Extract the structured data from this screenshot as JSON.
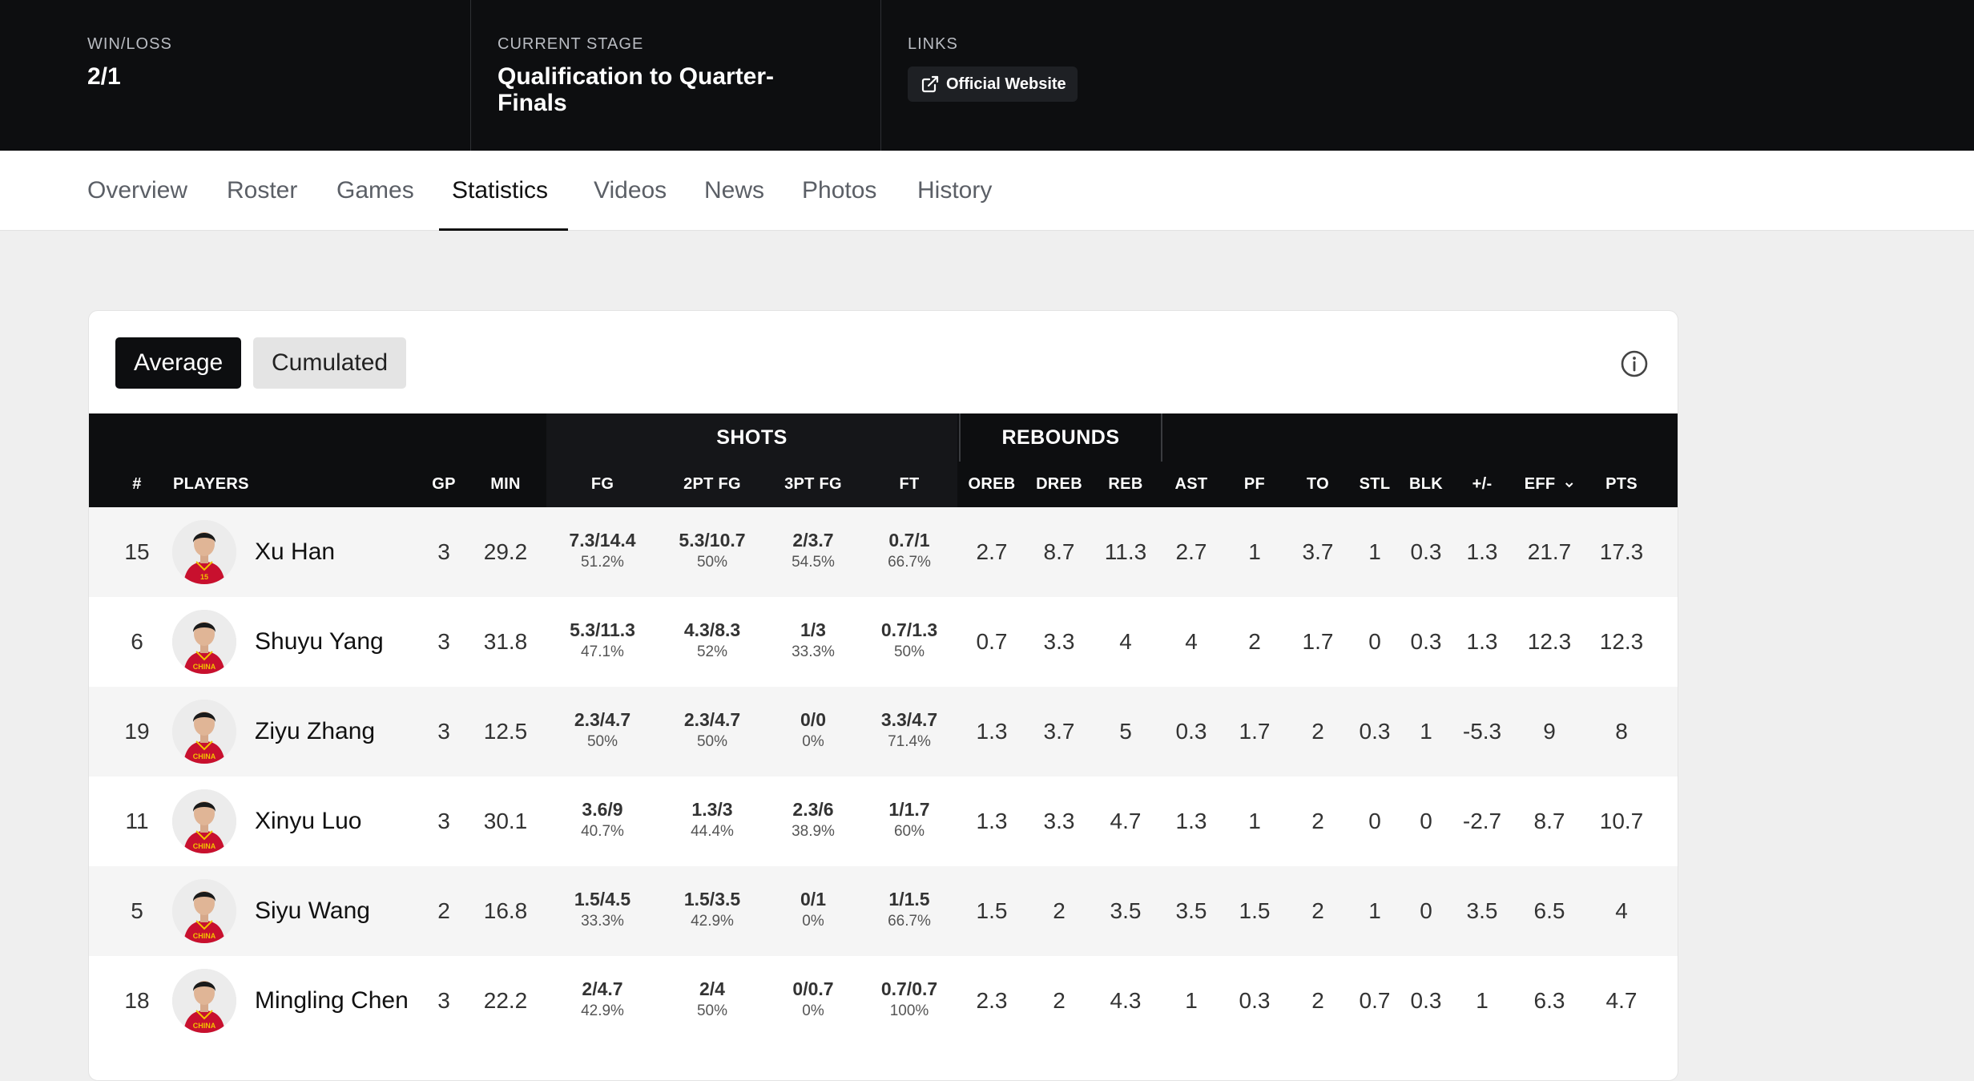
{
  "header": {
    "winloss_label": "WIN/LOSS",
    "winloss_value": "2/1",
    "stage_label": "CURRENT STAGE",
    "stage_value": "Qualification to Quarter-Finals",
    "links_label": "LINKS",
    "link_official": "Official Website"
  },
  "tabs": [
    "Overview",
    "Roster",
    "Games",
    "Statistics",
    "Videos",
    "News",
    "Photos",
    "History"
  ],
  "active_tab": "Statistics",
  "toggles": {
    "average": "Average",
    "cumulated": "Cumulated"
  },
  "table": {
    "groups": {
      "shots": "SHOTS",
      "rebounds": "REBOUNDS"
    },
    "columns": {
      "num": "#",
      "players": "PLAYERS",
      "gp": "GP",
      "min": "MIN",
      "fg": "FG",
      "pt2": "2PT FG",
      "pt3": "3PT FG",
      "ft": "FT",
      "oreb": "OREB",
      "dreb": "DREB",
      "reb": "REB",
      "ast": "AST",
      "pf": "PF",
      "to": "TO",
      "stl": "STL",
      "blk": "BLK",
      "pm": "+/-",
      "eff": "EFF",
      "pts": "PTS"
    },
    "rows": [
      {
        "num": "15",
        "name": "Xu Han",
        "gp": "3",
        "min": "29.2",
        "fg": "7.3/14.4",
        "fg_pct": "51.2%",
        "pt2": "5.3/10.7",
        "pt2_pct": "50%",
        "pt3": "2/3.7",
        "pt3_pct": "54.5%",
        "ft": "0.7/1",
        "ft_pct": "66.7%",
        "oreb": "2.7",
        "dreb": "8.7",
        "reb": "11.3",
        "ast": "2.7",
        "pf": "1",
        "to": "3.7",
        "stl": "1",
        "blk": "0.3",
        "pm": "1.3",
        "eff": "21.7",
        "pts": "17.3",
        "jersey": "15"
      },
      {
        "num": "6",
        "name": "Shuyu Yang",
        "gp": "3",
        "min": "31.8",
        "fg": "5.3/11.3",
        "fg_pct": "47.1%",
        "pt2": "4.3/8.3",
        "pt2_pct": "52%",
        "pt3": "1/3",
        "pt3_pct": "33.3%",
        "ft": "0.7/1.3",
        "ft_pct": "50%",
        "oreb": "0.7",
        "dreb": "3.3",
        "reb": "4",
        "ast": "4",
        "pf": "2",
        "to": "1.7",
        "stl": "0",
        "blk": "0.3",
        "pm": "1.3",
        "eff": "12.3",
        "pts": "12.3",
        "jersey": "CHINA"
      },
      {
        "num": "19",
        "name": "Ziyu Zhang",
        "gp": "3",
        "min": "12.5",
        "fg": "2.3/4.7",
        "fg_pct": "50%",
        "pt2": "2.3/4.7",
        "pt2_pct": "50%",
        "pt3": "0/0",
        "pt3_pct": "0%",
        "ft": "3.3/4.7",
        "ft_pct": "71.4%",
        "oreb": "1.3",
        "dreb": "3.7",
        "reb": "5",
        "ast": "0.3",
        "pf": "1.7",
        "to": "2",
        "stl": "0.3",
        "blk": "1",
        "pm": "-5.3",
        "eff": "9",
        "pts": "8",
        "jersey": "CHINA"
      },
      {
        "num": "11",
        "name": "Xinyu Luo",
        "gp": "3",
        "min": "30.1",
        "fg": "3.6/9",
        "fg_pct": "40.7%",
        "pt2": "1.3/3",
        "pt2_pct": "44.4%",
        "pt3": "2.3/6",
        "pt3_pct": "38.9%",
        "ft": "1/1.7",
        "ft_pct": "60%",
        "oreb": "1.3",
        "dreb": "3.3",
        "reb": "4.7",
        "ast": "1.3",
        "pf": "1",
        "to": "2",
        "stl": "0",
        "blk": "0",
        "pm": "-2.7",
        "eff": "8.7",
        "pts": "10.7",
        "jersey": "CHINA"
      },
      {
        "num": "5",
        "name": "Siyu Wang",
        "gp": "2",
        "min": "16.8",
        "fg": "1.5/4.5",
        "fg_pct": "33.3%",
        "pt2": "1.5/3.5",
        "pt2_pct": "42.9%",
        "pt3": "0/1",
        "pt3_pct": "0%",
        "ft": "1/1.5",
        "ft_pct": "66.7%",
        "oreb": "1.5",
        "dreb": "2",
        "reb": "3.5",
        "ast": "3.5",
        "pf": "1.5",
        "to": "2",
        "stl": "1",
        "blk": "0",
        "pm": "3.5",
        "eff": "6.5",
        "pts": "4",
        "jersey": "CHINA"
      },
      {
        "num": "18",
        "name": "Mingling Chen",
        "gp": "3",
        "min": "22.2",
        "fg": "2/4.7",
        "fg_pct": "42.9%",
        "pt2": "2/4",
        "pt2_pct": "50%",
        "pt3": "0/0.7",
        "pt3_pct": "0%",
        "ft": "0.7/0.7",
        "ft_pct": "100%",
        "oreb": "2.3",
        "dreb": "2",
        "reb": "4.3",
        "ast": "1",
        "pf": "0.3",
        "to": "2",
        "stl": "0.7",
        "blk": "0.3",
        "pm": "1",
        "eff": "6.3",
        "pts": "4.7",
        "jersey": "CHINA"
      }
    ]
  },
  "colors": {
    "header_bg": "#0d0e10",
    "jersey_red": "#c8102e",
    "jersey_gold": "#f2c200"
  }
}
